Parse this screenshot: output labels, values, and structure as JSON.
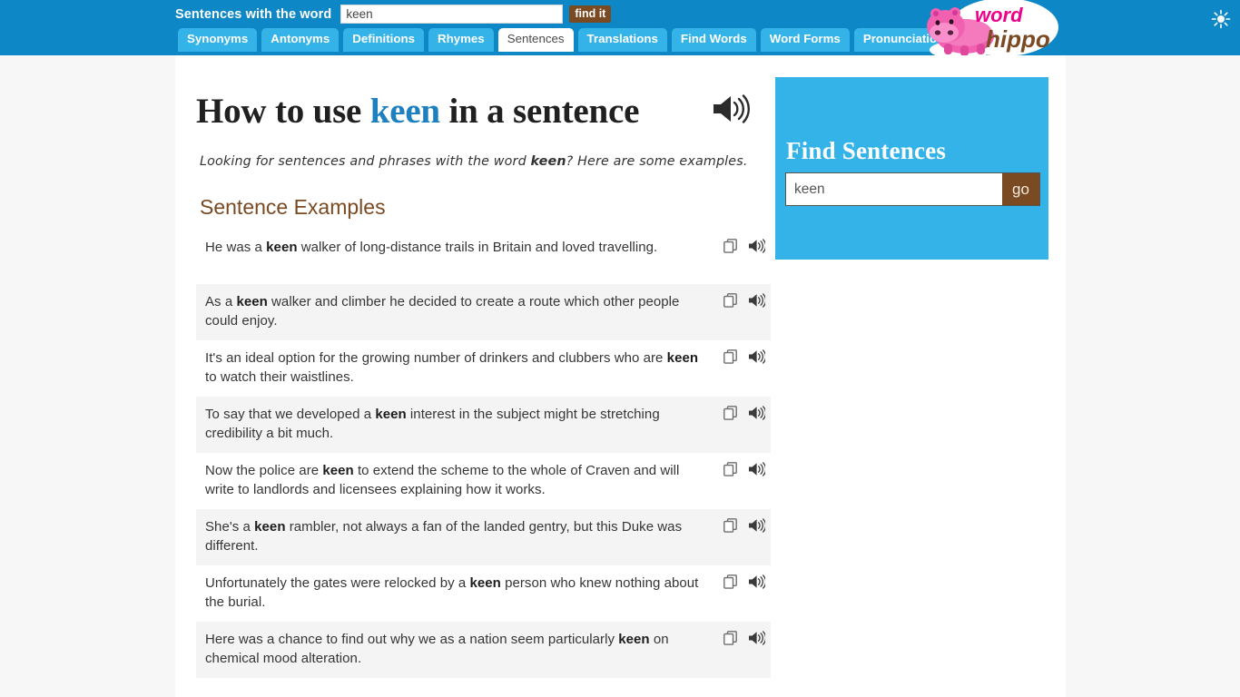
{
  "header": {
    "search_label": "Sentences with the word",
    "search_value": "keen",
    "search_placeholder": "",
    "find_button": "find it",
    "theme_toggle_icon": "sun-icon"
  },
  "nav": {
    "tabs": [
      {
        "label": "Synonyms",
        "active": false
      },
      {
        "label": "Antonyms",
        "active": false
      },
      {
        "label": "Definitions",
        "active": false
      },
      {
        "label": "Rhymes",
        "active": false
      },
      {
        "label": "Sentences",
        "active": true
      },
      {
        "label": "Translations",
        "active": false
      },
      {
        "label": "Find Words",
        "active": false
      },
      {
        "label": "Word Forms",
        "active": false
      },
      {
        "label": "Pronunciations",
        "active": false
      }
    ]
  },
  "logo": {
    "word_part": "word",
    "hippo_part": "hippo",
    "word_color": "#ec008c",
    "hippo_color": "#7a4a22",
    "hippo_body_color": "#f260b0"
  },
  "main": {
    "title_prefix": "How to use ",
    "title_keyword": "keen",
    "title_suffix": " in a sentence",
    "title_speaker_icon": "speaker-icon",
    "subtitle_before": "Looking for sentences and phrases with the word ",
    "subtitle_keyword": "keen",
    "subtitle_after": "? Here are some examples.",
    "section_title": "Sentence Examples",
    "copy_icon": "copy-icon",
    "speaker_icon": "speaker-icon",
    "sentences": [
      {
        "before": "He was a ",
        "keyword": "keen",
        "after": " walker of long-distance trails in Britain and loved travelling."
      },
      {
        "before": "As a ",
        "keyword": "keen",
        "after": " walker and climber he decided to create a route which other people could enjoy."
      },
      {
        "before": "It's an ideal option for the growing number of drinkers and clubbers who are ",
        "keyword": "keen",
        "after": " to watch their waistlines."
      },
      {
        "before": "To say that we developed a ",
        "keyword": "keen",
        "after": " interest in the subject might be stretching credibility a bit much."
      },
      {
        "before": "Now the police are ",
        "keyword": "keen",
        "after": " to extend the scheme to the whole of Craven and will write to landlords and licensees explaining how it works."
      },
      {
        "before": "She's a ",
        "keyword": "keen",
        "after": " rambler, not always a fan of the landed gentry, but this Duke was different."
      },
      {
        "before": "Unfortunately the gates were relocked by a ",
        "keyword": "keen",
        "after": " person who knew nothing about the burial."
      },
      {
        "before": "Here was a chance to find out why we as a nation seem particularly ",
        "keyword": "keen",
        "after": " on chemical mood alteration."
      }
    ]
  },
  "sidebar": {
    "title": "Find Sentences",
    "input_value": "keen",
    "input_placeholder": "",
    "go_button": "go",
    "background_color": "#34b3e8"
  },
  "colors": {
    "header_blue": "#0d87c5",
    "tab_blue": "#34b3e8",
    "brown": "#7a4a22",
    "keyword_blue": "#1f80c0",
    "page_bg": "#f7f7f7",
    "row_alt_bg": "#f4f4f4"
  }
}
